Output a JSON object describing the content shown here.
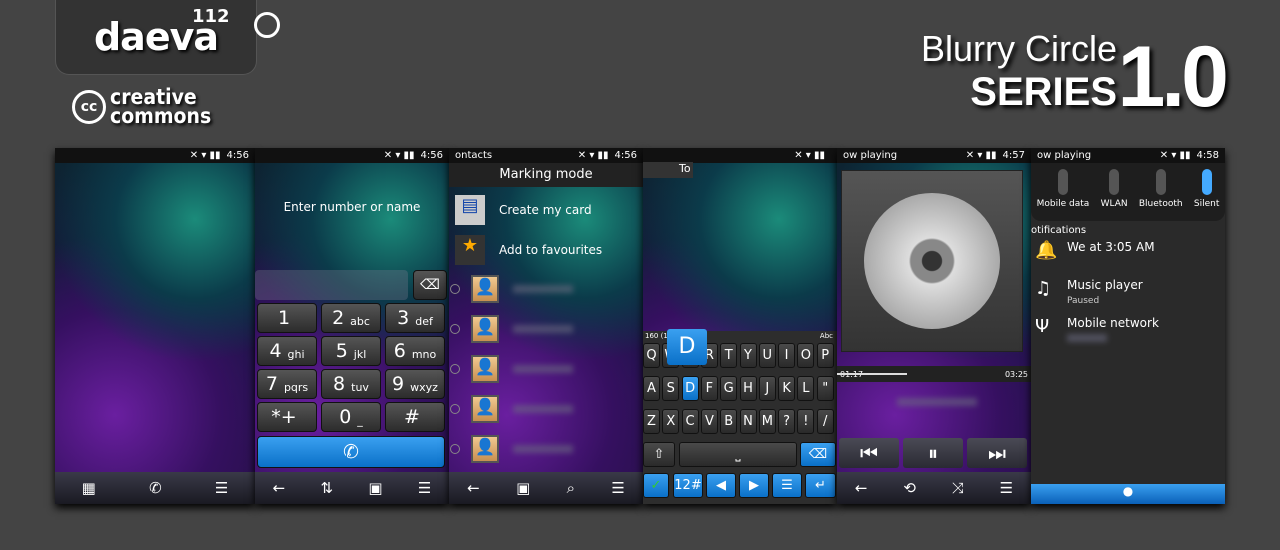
{
  "branding": {
    "logo": "daeva",
    "logo_sup": "112",
    "cc_symbol": "cc",
    "cc_line1": "creative",
    "cc_line2": "commons",
    "title_line1": "Blurry Circle",
    "title_line2": "SERIES",
    "version": "1.0"
  },
  "colors": {
    "background": "#444444",
    "accent": "#1a88e0"
  },
  "screens": [
    {
      "status": {
        "label": "",
        "time": "4:56"
      },
      "toolbar": [
        "grid-icon",
        "phone-icon",
        "menu-icon"
      ]
    },
    {
      "status": {
        "label": "",
        "time": "4:56"
      },
      "prompt": "Enter number or name",
      "keys": [
        [
          "1",
          ""
        ],
        [
          "2",
          "abc"
        ],
        [
          "3",
          "def"
        ],
        [
          "4",
          "ghi"
        ],
        [
          "5",
          "jkl"
        ],
        [
          "6",
          "mno"
        ],
        [
          "7",
          "pqrs"
        ],
        [
          "8",
          "tuv"
        ],
        [
          "9",
          "wxyz"
        ],
        [
          "*+",
          ""
        ],
        [
          "0",
          "_"
        ],
        [
          "#",
          ""
        ]
      ],
      "toolbar": [
        "back-icon",
        "swap-icon",
        "contacts-icon",
        "menu-icon"
      ]
    },
    {
      "status": {
        "label": "ontacts",
        "time": "4:56"
      },
      "header": "Marking mode",
      "actions": [
        "Create my card",
        "Add to favourites"
      ],
      "toolbar": [
        "back-icon",
        "contacts-icon",
        "search-icon",
        "menu-icon"
      ]
    },
    {
      "status": {
        "label": "",
        "time": ""
      },
      "to_label": "To",
      "counter": "160 (1)",
      "input_mode": "Abc",
      "preview_key": "D",
      "rows": [
        "QWERTYUIOP",
        "ASDFGHJKL\"",
        "ZXCVBNM?!/"
      ],
      "mode_key": "12#"
    },
    {
      "status": {
        "label": "ow playing",
        "time": "4:57"
      },
      "elapsed": "01:17",
      "duration": "03:25",
      "progress": 0.36,
      "toolbar": [
        "back-icon",
        "repeat-icon",
        "shuffle-icon",
        "menu-icon"
      ]
    },
    {
      "status": {
        "label": "ow playing",
        "time": "4:58"
      },
      "toggles": [
        "Mobile data",
        "WLAN",
        "Bluetooth",
        "Silent"
      ],
      "notifications_header": "otifications",
      "notifications": [
        {
          "title": "We at 3:05 AM",
          "sub": "",
          "icon": "alarm-icon"
        },
        {
          "title": "Music player",
          "sub": "Paused",
          "icon": "music-note-icon"
        },
        {
          "title": "Mobile network",
          "sub": "",
          "icon": "antenna-icon"
        }
      ]
    }
  ]
}
